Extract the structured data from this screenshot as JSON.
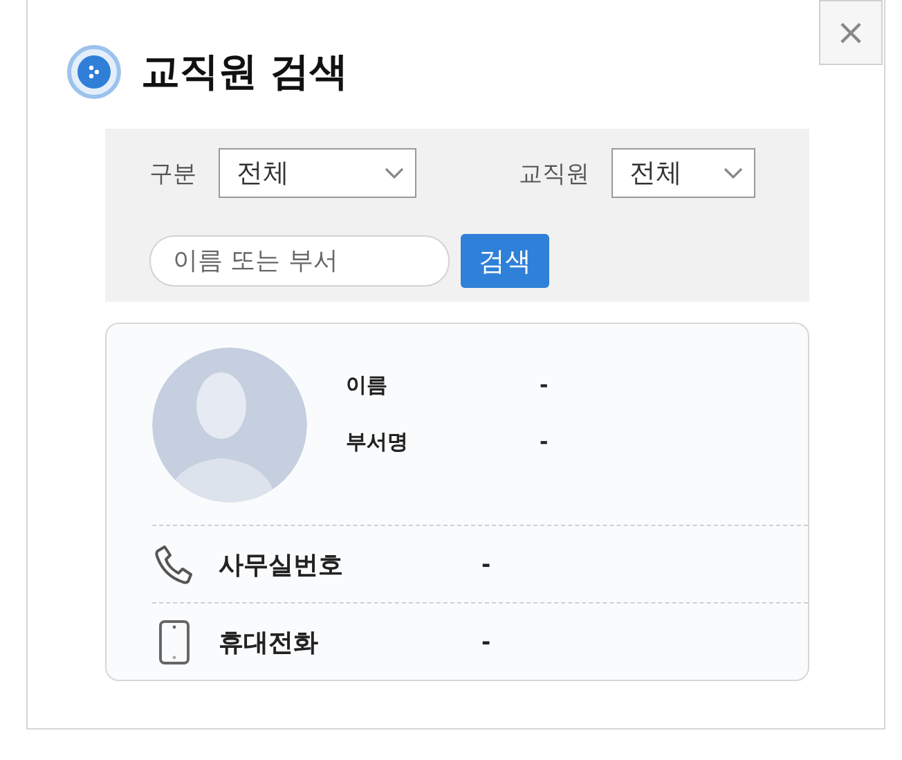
{
  "dialog": {
    "title": "교직원 검색",
    "close": "×"
  },
  "filters": [
    {
      "label": "구분",
      "value": "전체"
    },
    {
      "label": "교직원",
      "value": "전체"
    }
  ],
  "search": {
    "placeholder": "이름 또는 부서",
    "button": "검색"
  },
  "profile": {
    "fields": [
      {
        "label": "이름",
        "value": "-"
      },
      {
        "label": "부서명",
        "value": "-"
      }
    ],
    "contacts": [
      {
        "kind": "phone",
        "label": "사무실번호",
        "value": "-"
      },
      {
        "kind": "mobile",
        "label": "휴대전화",
        "value": "-"
      }
    ]
  }
}
